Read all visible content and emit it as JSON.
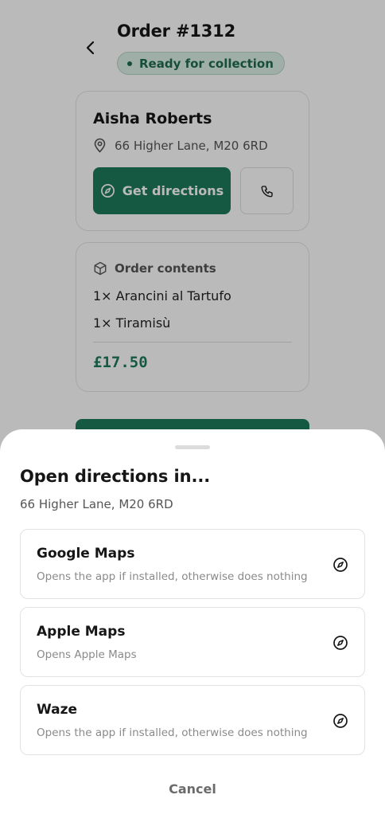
{
  "header": {
    "back_icon": "chevron-left-icon",
    "order_title": "Order #1312",
    "status": "Ready for collection"
  },
  "customer": {
    "name": "Aisha Roberts",
    "address": "66 Higher Lane, M20 6RD",
    "directions_label": "Get directions",
    "call_icon": "phone-icon"
  },
  "order_contents": {
    "heading": "Order contents",
    "items": [
      "1× Arancini al Tartufo",
      "1× Tiramisù"
    ],
    "total": "£17.50"
  },
  "sheet": {
    "title": "Open directions in...",
    "address": "66 Higher Lane, M20 6RD",
    "options": [
      {
        "title": "Google Maps",
        "description": "Opens the app if installed, otherwise does nothing",
        "icon": "compass-icon"
      },
      {
        "title": "Apple Maps",
        "description": "Opens Apple Maps",
        "icon": "compass-icon"
      },
      {
        "title": "Waze",
        "description": "Opens the app if installed, otherwise does nothing",
        "icon": "compass-icon"
      }
    ],
    "cancel_label": "Cancel"
  },
  "colors": {
    "accent": "#1f7a5c",
    "status_bg": "#dcefe6",
    "overlay": "rgba(0,0,0,0.27)"
  }
}
